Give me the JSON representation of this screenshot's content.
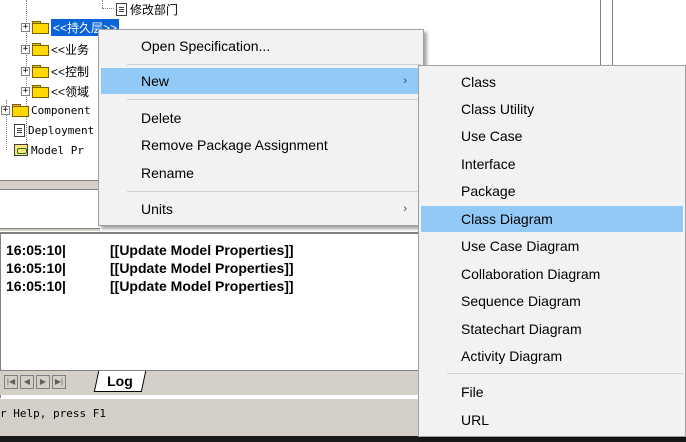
{
  "tree": {
    "items": [
      {
        "label": "修改部门",
        "expander": ""
      },
      {
        "label": "<<持久层>>",
        "expander": "+"
      },
      {
        "label": "<<业务",
        "expander": "+"
      },
      {
        "label": "<<控制",
        "expander": "+"
      },
      {
        "label": "<<领域",
        "expander": "+"
      },
      {
        "label": "Component",
        "expander": "+"
      },
      {
        "label": "Deployment",
        "expander": ""
      },
      {
        "label": "Model Pr",
        "expander": ""
      }
    ]
  },
  "log": {
    "lines": [
      {
        "time": "16:05:10|",
        "message": "[[Update Model Properties]]"
      },
      {
        "time": "16:05:10|",
        "message": "[[Update Model Properties]]"
      },
      {
        "time": "16:05:10|",
        "message": "[[Update Model Properties]]"
      }
    ],
    "tab_label": "Log",
    "nav": [
      "|◀",
      "◀",
      "▶",
      "▶|"
    ]
  },
  "status": {
    "text": "r Help, press F1"
  },
  "context_menu": {
    "items": [
      {
        "label": "Open Specification...",
        "submenu": false
      },
      {
        "label": "New",
        "submenu": true,
        "highlighted": true
      },
      {
        "label": "Delete",
        "submenu": false
      },
      {
        "label": "Remove Package Assignment",
        "submenu": false
      },
      {
        "label": "Rename",
        "submenu": false
      },
      {
        "label": "Units",
        "submenu": true
      }
    ],
    "submenu_arrow": "›"
  },
  "new_submenu": {
    "items": [
      {
        "label": "Class"
      },
      {
        "label": "Class Utility"
      },
      {
        "label": "Use Case"
      },
      {
        "label": "Interface"
      },
      {
        "label": "Package"
      },
      {
        "label": "Class Diagram",
        "highlighted": true
      },
      {
        "label": "Use Case Diagram"
      },
      {
        "label": "Collaboration Diagram"
      },
      {
        "label": "Sequence Diagram"
      },
      {
        "label": "Statechart Diagram"
      },
      {
        "label": "Activity Diagram"
      },
      {
        "label": "File"
      },
      {
        "label": "URL"
      }
    ]
  },
  "colors": {
    "selection": "#0a64d8",
    "menu_hover": "#91c9f7",
    "menu_bg": "#f2f2f2",
    "folder": "#ffd800"
  }
}
